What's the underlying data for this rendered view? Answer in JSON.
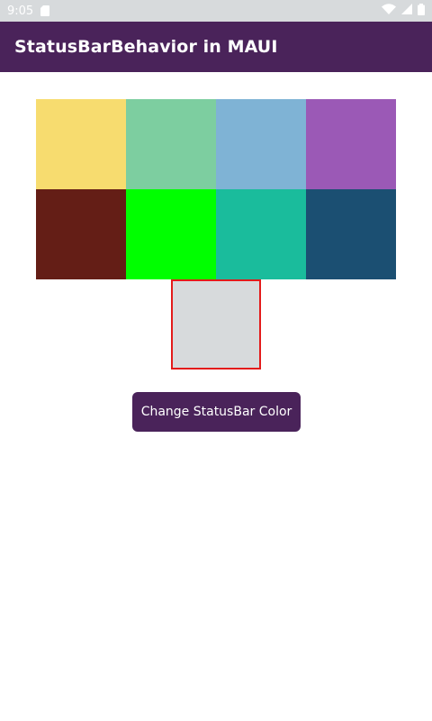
{
  "status_bar": {
    "time": "9:05",
    "icons": [
      "sd-card-icon",
      "wifi-icon",
      "cell-signal-icon",
      "battery-icon"
    ]
  },
  "app_bar": {
    "title": "StatusBarBehavior in MAUI",
    "color": "#4a235a"
  },
  "palette": [
    {
      "name": "yellow",
      "color": "#f7dc6f"
    },
    {
      "name": "mint",
      "color": "#7dcea0"
    },
    {
      "name": "light-blue",
      "color": "#7fb3d5"
    },
    {
      "name": "purple",
      "color": "#9b59b6"
    },
    {
      "name": "dark-red",
      "color": "#641e16"
    },
    {
      "name": "lime",
      "color": "#00ff00"
    },
    {
      "name": "teal",
      "color": "#1abc9c"
    },
    {
      "name": "navy",
      "color": "#1b4f72"
    }
  ],
  "selected_preview": {
    "color": "#d7dadc",
    "border_color": "#e31b1b"
  },
  "button": {
    "label": "Change StatusBar Color",
    "color": "#4a235a"
  }
}
